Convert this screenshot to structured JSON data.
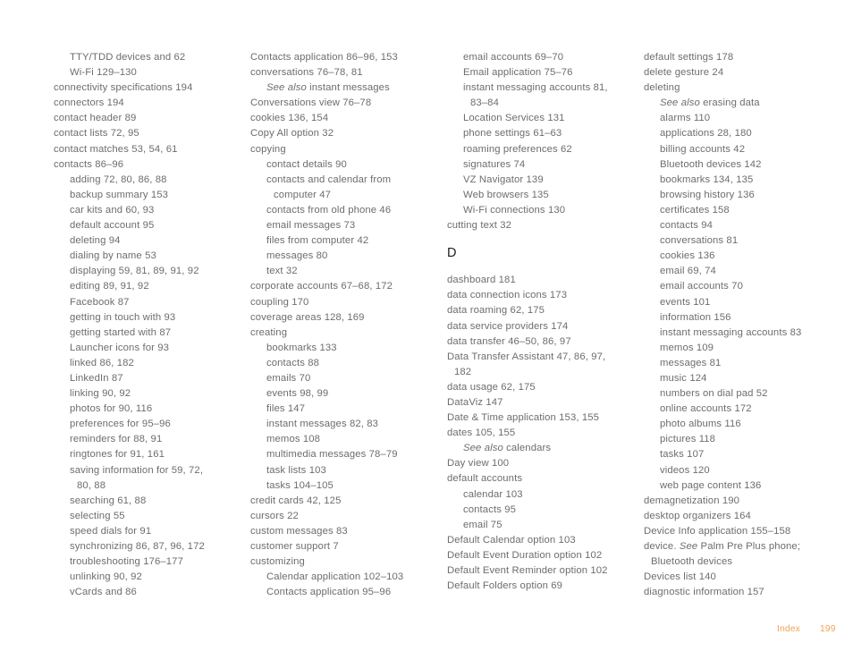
{
  "page": {
    "type": "book-index",
    "footer_label": "Index",
    "footer_page": "199",
    "footer_color": "#f0a254",
    "body_text_color": "#6d6d6d",
    "heading_color": "#1c1c1c",
    "background_color": "#ffffff"
  },
  "columns": [
    {
      "id": "column-1",
      "entries": [
        {
          "level": 1,
          "text": "TTY/TDD devices and 62"
        },
        {
          "level": 1,
          "text": "Wi-Fi 129–130"
        },
        {
          "level": 0,
          "text": "connectivity specifications 194"
        },
        {
          "level": 0,
          "text": "connectors 194"
        },
        {
          "level": 0,
          "text": "contact header 89"
        },
        {
          "level": 0,
          "text": "contact lists 72, 95"
        },
        {
          "level": 0,
          "text": "contact matches 53, 54, 61"
        },
        {
          "level": 0,
          "text": "contacts 86–96"
        },
        {
          "level": 1,
          "text": "adding 72, 80, 86, 88"
        },
        {
          "level": 1,
          "text": "backup summary 153"
        },
        {
          "level": 1,
          "text": "car kits and 60, 93"
        },
        {
          "level": 1,
          "text": "default account 95"
        },
        {
          "level": 1,
          "text": "deleting 94"
        },
        {
          "level": 1,
          "text": "dialing by name 53"
        },
        {
          "level": 1,
          "text": "displaying 59, 81, 89, 91, 92"
        },
        {
          "level": 1,
          "text": "editing 89, 91, 92"
        },
        {
          "level": 1,
          "text": "Facebook 87"
        },
        {
          "level": 1,
          "text": "getting in touch with 93"
        },
        {
          "level": 1,
          "text": "getting started with 87"
        },
        {
          "level": 1,
          "text": "Launcher icons for 93"
        },
        {
          "level": 1,
          "text": "linked 86, 182"
        },
        {
          "level": 1,
          "text": "LinkedIn 87"
        },
        {
          "level": 1,
          "text": "linking 90, 92"
        },
        {
          "level": 1,
          "text": "photos for 90, 116"
        },
        {
          "level": 1,
          "text": "preferences for 95–96"
        },
        {
          "level": 1,
          "text": "reminders for 88, 91"
        },
        {
          "level": 1,
          "text": "ringtones for 91, 161"
        },
        {
          "level": 1,
          "text": "saving information for 59, 72,"
        },
        {
          "level": "cont1",
          "text": "80, 88"
        },
        {
          "level": 1,
          "text": "searching 61, 88"
        },
        {
          "level": 1,
          "text": "selecting 55"
        },
        {
          "level": 1,
          "text": "speed dials for 91"
        },
        {
          "level": 1,
          "text": "synchronizing 86, 87, 96, 172"
        },
        {
          "level": 1,
          "text": "troubleshooting 176–177"
        },
        {
          "level": 1,
          "text": "unlinking 90, 92"
        },
        {
          "level": 1,
          "text": "vCards and 86"
        }
      ]
    },
    {
      "id": "column-2",
      "entries": [
        {
          "level": 0,
          "text": "Contacts application 86–96, 153"
        },
        {
          "level": 0,
          "text": "conversations 76–78, 81"
        },
        {
          "level": 1,
          "italic_prefix": "See also",
          "text": " instant messages"
        },
        {
          "level": 0,
          "text": "Conversations view 76–78"
        },
        {
          "level": 0,
          "text": "cookies 136, 154"
        },
        {
          "level": 0,
          "text": "Copy All option 32"
        },
        {
          "level": 0,
          "text": "copying"
        },
        {
          "level": 1,
          "text": "contact details 90"
        },
        {
          "level": 1,
          "text": "contacts and calendar from"
        },
        {
          "level": "cont1",
          "text": "computer 47"
        },
        {
          "level": 1,
          "text": "contacts from old phone 46"
        },
        {
          "level": 1,
          "text": "email messages 73"
        },
        {
          "level": 1,
          "text": "files from computer 42"
        },
        {
          "level": 1,
          "text": "messages 80"
        },
        {
          "level": 1,
          "text": "text 32"
        },
        {
          "level": 0,
          "text": "corporate accounts 67–68, 172"
        },
        {
          "level": 0,
          "text": "coupling 170"
        },
        {
          "level": 0,
          "text": "coverage areas 128, 169"
        },
        {
          "level": 0,
          "text": "creating"
        },
        {
          "level": 1,
          "text": "bookmarks 133"
        },
        {
          "level": 1,
          "text": "contacts 88"
        },
        {
          "level": 1,
          "text": "emails 70"
        },
        {
          "level": 1,
          "text": "events 98, 99"
        },
        {
          "level": 1,
          "text": "files 147"
        },
        {
          "level": 1,
          "text": "instant messages 82, 83"
        },
        {
          "level": 1,
          "text": "memos 108"
        },
        {
          "level": 1,
          "text": "multimedia messages 78–79"
        },
        {
          "level": 1,
          "text": "task lists 103"
        },
        {
          "level": 1,
          "text": "tasks 104–105"
        },
        {
          "level": 0,
          "text": "credit cards 42, 125"
        },
        {
          "level": 0,
          "text": "cursors 22"
        },
        {
          "level": 0,
          "text": "custom messages 83"
        },
        {
          "level": 0,
          "text": "customer support 7"
        },
        {
          "level": 0,
          "text": "customizing"
        },
        {
          "level": 1,
          "text": "Calendar application 102–103"
        },
        {
          "level": 1,
          "text": "Contacts application 95–96"
        }
      ]
    },
    {
      "id": "column-3",
      "entries": [
        {
          "level": 1,
          "text": "email accounts 69–70"
        },
        {
          "level": 1,
          "text": "Email application 75–76"
        },
        {
          "level": 1,
          "text": "instant messaging accounts 81,"
        },
        {
          "level": "cont1",
          "text": "83–84"
        },
        {
          "level": 1,
          "text": "Location Services 131"
        },
        {
          "level": 1,
          "text": "phone settings 61–63"
        },
        {
          "level": 1,
          "text": "roaming preferences 62"
        },
        {
          "level": 1,
          "text": "signatures 74"
        },
        {
          "level": 1,
          "text": "VZ Navigator 139"
        },
        {
          "level": 1,
          "text": "Web browsers 135"
        },
        {
          "level": 1,
          "text": "Wi-Fi connections 130"
        },
        {
          "level": 0,
          "text": "cutting text 32"
        },
        {
          "level": "head",
          "text": "D"
        },
        {
          "level": 0,
          "text": "dashboard 181"
        },
        {
          "level": 0,
          "text": "data connection icons 173"
        },
        {
          "level": 0,
          "text": "data roaming 62, 175"
        },
        {
          "level": 0,
          "text": "data service providers 174"
        },
        {
          "level": 0,
          "text": "data transfer 46–50, 86, 97"
        },
        {
          "level": 0,
          "text": "Data Transfer Assistant 47, 86, 97,"
        },
        {
          "level": "cont0",
          "text": "182"
        },
        {
          "level": 0,
          "text": "data usage 62, 175"
        },
        {
          "level": 0,
          "text": "DataViz 147"
        },
        {
          "level": 0,
          "text": "Date & Time application 153, 155"
        },
        {
          "level": 0,
          "text": "dates 105, 155"
        },
        {
          "level": 1,
          "italic_prefix": "See also",
          "text": " calendars"
        },
        {
          "level": 0,
          "text": "Day view 100"
        },
        {
          "level": 0,
          "text": "default accounts"
        },
        {
          "level": 1,
          "text": "calendar 103"
        },
        {
          "level": 1,
          "text": "contacts 95"
        },
        {
          "level": 1,
          "text": "email 75"
        },
        {
          "level": 0,
          "text": "Default Calendar option 103"
        },
        {
          "level": 0,
          "text": "Default Event Duration option 102"
        },
        {
          "level": 0,
          "text": "Default Event Reminder option 102"
        },
        {
          "level": 0,
          "text": "Default Folders option 69"
        }
      ]
    },
    {
      "id": "column-4",
      "entries": [
        {
          "level": 0,
          "text": "default settings 178"
        },
        {
          "level": 0,
          "text": "delete gesture 24"
        },
        {
          "level": 0,
          "text": "deleting"
        },
        {
          "level": 1,
          "italic_prefix": "See also",
          "text": " erasing data"
        },
        {
          "level": 1,
          "text": "alarms 110"
        },
        {
          "level": 1,
          "text": "applications 28, 180"
        },
        {
          "level": 1,
          "text": "billing accounts 42"
        },
        {
          "level": 1,
          "text": "Bluetooth devices 142"
        },
        {
          "level": 1,
          "text": "bookmarks 134, 135"
        },
        {
          "level": 1,
          "text": "browsing history 136"
        },
        {
          "level": 1,
          "text": "certificates 158"
        },
        {
          "level": 1,
          "text": "contacts 94"
        },
        {
          "level": 1,
          "text": "conversations 81"
        },
        {
          "level": 1,
          "text": "cookies 136"
        },
        {
          "level": 1,
          "text": "email 69, 74"
        },
        {
          "level": 1,
          "text": "email accounts 70"
        },
        {
          "level": 1,
          "text": "events 101"
        },
        {
          "level": 1,
          "text": "information 156"
        },
        {
          "level": 1,
          "text": "instant messaging accounts 83"
        },
        {
          "level": 1,
          "text": "memos 109"
        },
        {
          "level": 1,
          "text": "messages 81"
        },
        {
          "level": 1,
          "text": "music 124"
        },
        {
          "level": 1,
          "text": "numbers on dial pad 52"
        },
        {
          "level": 1,
          "text": "online accounts 172"
        },
        {
          "level": 1,
          "text": "photo albums 116"
        },
        {
          "level": 1,
          "text": "pictures 118"
        },
        {
          "level": 1,
          "text": "tasks 107"
        },
        {
          "level": 1,
          "text": "videos 120"
        },
        {
          "level": 1,
          "text": "web page content 136"
        },
        {
          "level": 0,
          "text": "demagnetization 190"
        },
        {
          "level": 0,
          "text": "desktop organizers 164"
        },
        {
          "level": 0,
          "text": "Device Info application 155–158"
        },
        {
          "level": 0,
          "italic_word": "See",
          "text_before": "device. ",
          "text_after": " Palm Pre Plus phone;"
        },
        {
          "level": "cont0",
          "text": "Bluetooth devices"
        },
        {
          "level": 0,
          "text": "Devices list 140"
        },
        {
          "level": 0,
          "text": "diagnostic information 157"
        }
      ]
    }
  ]
}
